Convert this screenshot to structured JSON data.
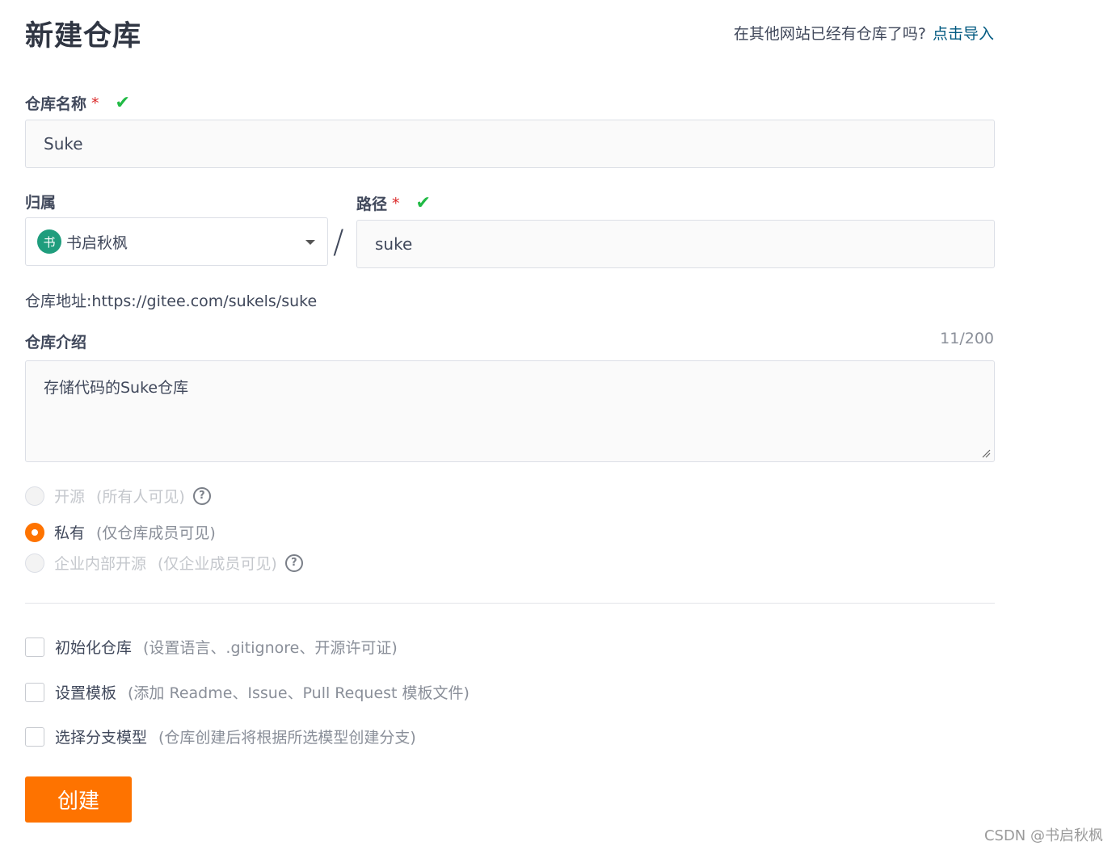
{
  "page_title": "新建仓库",
  "import": {
    "text": "在其他网站已经有仓库了吗?",
    "link": "点击导入"
  },
  "repo_name": {
    "label": "仓库名称",
    "required_mark": "*",
    "value": "Suke"
  },
  "owner": {
    "label": "归属",
    "avatar_char": "书",
    "value": "书启秋枫"
  },
  "path": {
    "label": "路径",
    "required_mark": "*",
    "value": "suke",
    "separator": "/"
  },
  "address": "仓库地址:https://gitee.com/sukels/suke",
  "intro": {
    "label": "仓库介绍",
    "counter": "11/200",
    "value": "存储代码的Suke仓库"
  },
  "visibility": {
    "options": [
      {
        "label": "开源",
        "note": "(所有人可见)",
        "selected": false,
        "disabled": true,
        "help": "?"
      },
      {
        "label": "私有",
        "note": "(仅仓库成员可见)",
        "selected": true,
        "disabled": false
      },
      {
        "label": "企业内部开源",
        "note": "(仅企业成员可见)",
        "selected": false,
        "disabled": true,
        "help": "?"
      }
    ]
  },
  "options": [
    {
      "label": "初始化仓库",
      "hint": "(设置语言、.gitignore、开源许可证)"
    },
    {
      "label": "设置模板",
      "hint": "(添加 Readme、Issue、Pull Request 模板文件)"
    },
    {
      "label": "选择分支模型",
      "hint": "(仓库创建后将根据所选模型创建分支)"
    }
  ],
  "submit_label": "创建",
  "watermark": "CSDN @书启秋枫",
  "colors": {
    "accent": "#fe7300",
    "valid": "#21ba45",
    "link": "#005980"
  }
}
